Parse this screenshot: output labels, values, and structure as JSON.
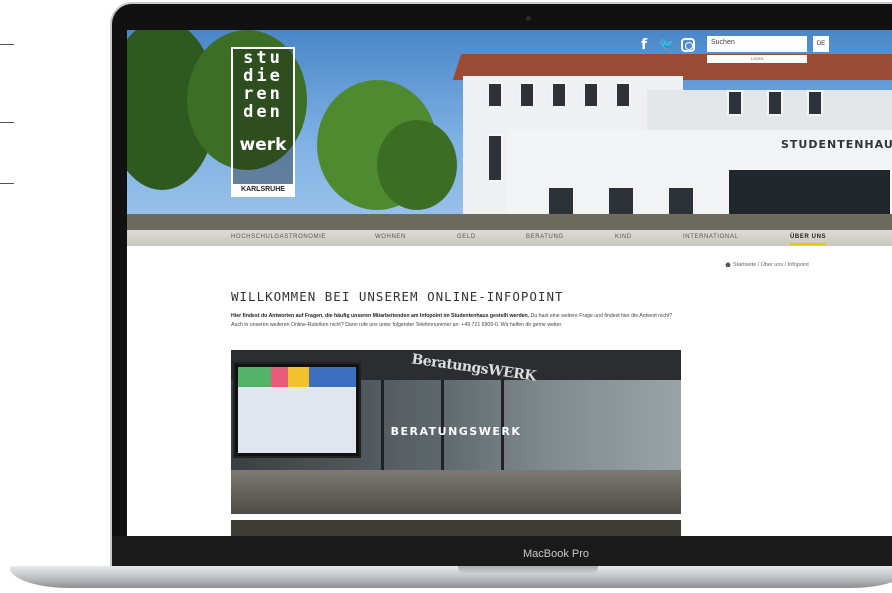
{
  "device": {
    "label": "MacBook Pro"
  },
  "header": {
    "logo_lines": [
      "stu",
      "die",
      "ren",
      "den"
    ],
    "logo_brand": "werk",
    "logo_city": "KARLSRUHE",
    "social": {
      "facebook": "f",
      "twitter": "🐦"
    },
    "search_placeholder": "Suchen",
    "language": "DE",
    "login": "LOGIN",
    "building_sign": "STUDENTENHAU"
  },
  "nav": {
    "items": [
      {
        "label": "HOCHSCHULGASTRONOMIE"
      },
      {
        "label": "WOHNEN"
      },
      {
        "label": "GELD"
      },
      {
        "label": "BERATUNG"
      },
      {
        "label": "KIND"
      },
      {
        "label": "INTERNATIONAL"
      },
      {
        "label": "ÜBER UNS"
      }
    ],
    "active_color": "#e7c600"
  },
  "breadcrumb": {
    "text": "Startseite / Über uns / Infopoint"
  },
  "main": {
    "heading": "WILLKOMMEN BEI UNSEREM ONLINE-INFOPOINT",
    "intro_bold": "Hier findest du Antworten auf Fragen, die häufig unseren Mitarbeitenden am Infopoint im Studentenhaus gestellt werden.",
    "intro_rest": " Du hast eine weitere Frage und findest hier die Antwort nicht? Auch in unseren weiteren Online-Rubriken nicht? Dann rufe uns unter folgender Telefonnummer an: +49 721 6909-0. Wir helfen dir gerne weiter.",
    "teaser_title": "BERATUNGSWERK",
    "teaser_sign": "BeratungsWERK"
  }
}
